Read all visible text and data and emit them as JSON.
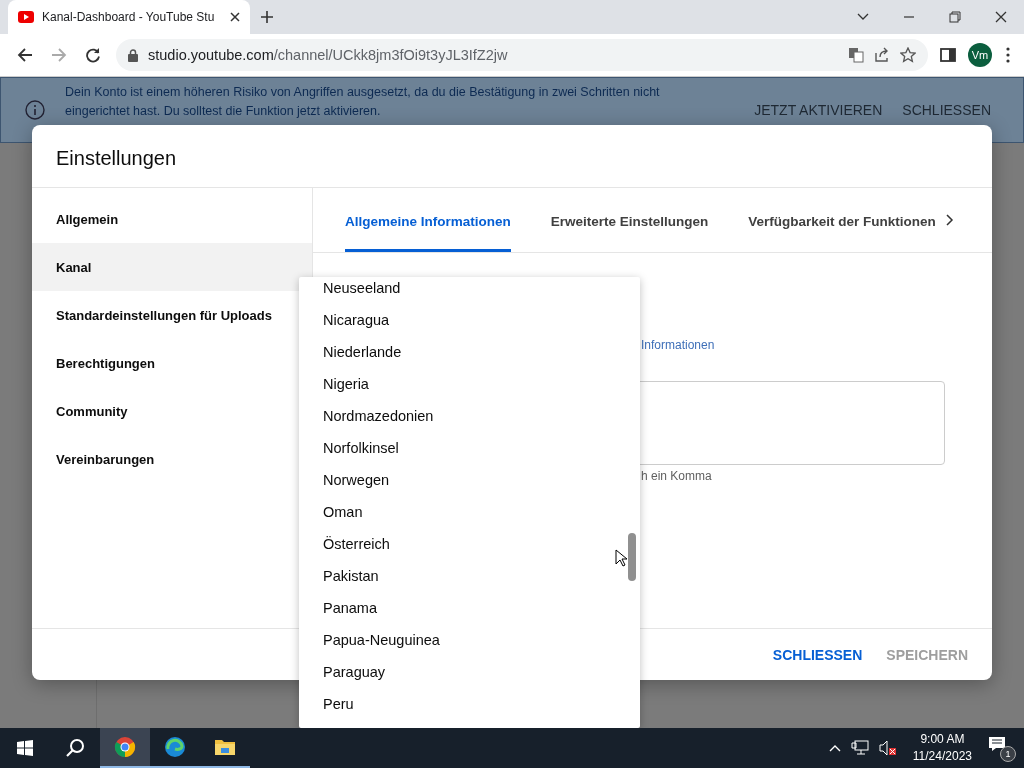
{
  "browser": {
    "tab_title": "Kanal-Dashboard - YouTube Stu",
    "url_host": "studio.youtube.com",
    "url_path": "/channel/UCkk8jm3fOi9t3yJL3IfZ2jw",
    "profile": "Vm"
  },
  "banner": {
    "lines": [
      "Dein Konto ist einem höheren Risiko von Angriffen ausgesetzt, da du die Bestätigung in zwei Schritten nicht",
      "eingerichtet hast. Du solltest die Funktion jetzt aktivieren."
    ],
    "actions": [
      "JETZT AKTIVIEREN",
      "SCHLIESSEN"
    ]
  },
  "dialog": {
    "title": "Einstellungen",
    "nav": [
      {
        "label": "Allgemein",
        "selected": false
      },
      {
        "label": "Kanal",
        "selected": true
      },
      {
        "label": "Standardeinstellungen für Uploads",
        "selected": false
      },
      {
        "label": "Berechtigungen",
        "selected": false
      },
      {
        "label": "Community",
        "selected": false
      },
      {
        "label": "Vereinbarungen",
        "selected": false
      }
    ],
    "tabs": [
      {
        "label": "Allgemeine Informationen",
        "selected": true
      },
      {
        "label": "Erweiterte Einstellungen",
        "selected": false
      },
      {
        "label": "Verfügbarkeit der Funktionen",
        "selected": false
      }
    ],
    "link_fragment": "Informationen",
    "hint_fragment": "h ein Komma",
    "buttons": [
      {
        "label": "SCHLIESSEN",
        "disabled": false
      },
      {
        "label": "SPEICHERN",
        "disabled": true
      }
    ]
  },
  "dropdown": {
    "options": [
      "Neuseeland",
      "Nicaragua",
      "Niederlande",
      "Nigeria",
      "Nordmazedonien",
      "Norfolkinsel",
      "Norwegen",
      "Oman",
      "Österreich",
      "Pakistan",
      "Panama",
      "Papua-Neuguinea",
      "Paraguay",
      "Peru"
    ]
  },
  "taskbar": {
    "time": "9:00 AM",
    "date": "11/24/2023",
    "notifications": "1"
  }
}
